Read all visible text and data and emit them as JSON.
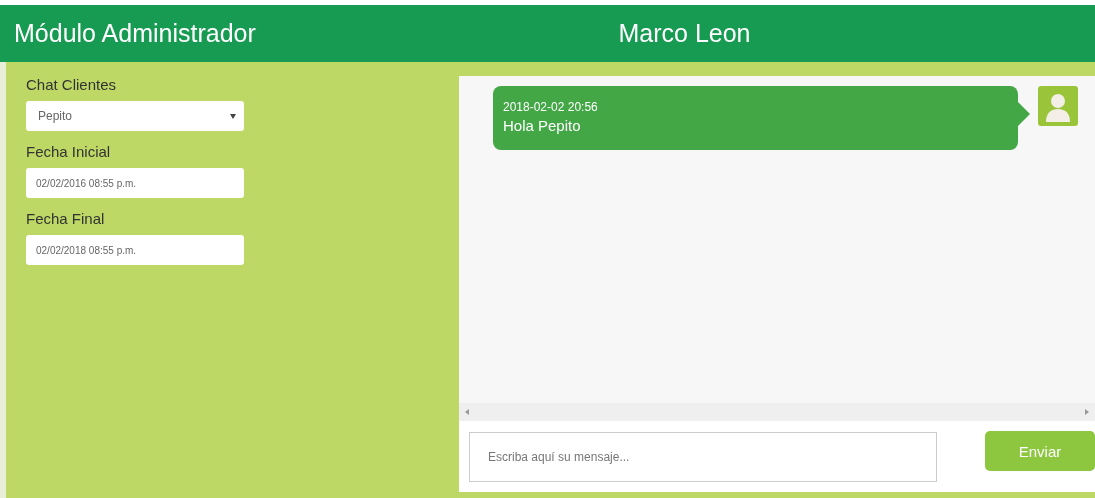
{
  "header": {
    "title": "Módulo Administrador",
    "user": "Marco Leon"
  },
  "filters": {
    "client_label": "Chat Clientes",
    "client_value": "Pepito",
    "start_label": "Fecha Inicial",
    "start_value": "02/02/2016 08:55 p.m.",
    "end_label": "Fecha Final",
    "end_value": "02/02/2018 08:55 p.m."
  },
  "messages": [
    {
      "time": "2018-02-02 20:56",
      "text": "Hola Pepito"
    }
  ],
  "composer": {
    "placeholder": "Escriba aquí su mensaje...",
    "send": "Enviar"
  }
}
